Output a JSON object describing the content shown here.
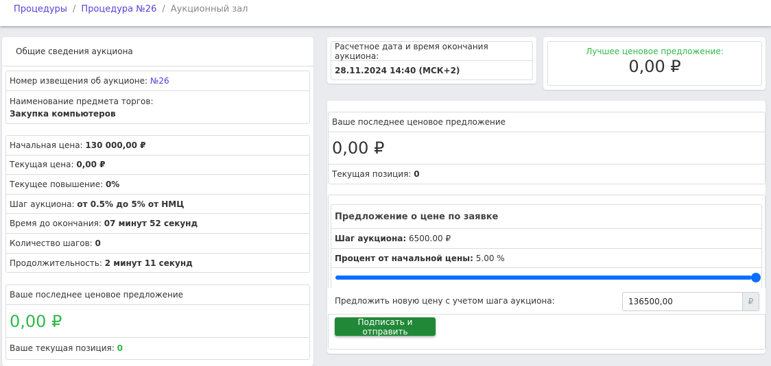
{
  "breadcrumb": {
    "items": [
      "Процедуры",
      "Процедура №26"
    ],
    "current": "Аукционный зал"
  },
  "general": {
    "title": "Общие сведения аукциона",
    "notice_label": "Номер извещения об аукционе:",
    "notice_value": "№26",
    "subject_label": "Наименование предмета торгов:",
    "subject_value": "Закупка компьютеров",
    "params": [
      {
        "label": "Начальная цена:",
        "value": "130 000,00 ₽"
      },
      {
        "label": "Текущая цена:",
        "value": "0,00 ₽"
      },
      {
        "label": "Текущее повышение:",
        "value": "0%"
      },
      {
        "label": "Шаг аукциона:",
        "value": "от 0.5% до 5% от НМЦ"
      },
      {
        "label": "Время до окончания:",
        "value": "07 минут 52 секунд"
      },
      {
        "label": "Количество шагов:",
        "value": "0"
      },
      {
        "label": "Продолжительность:",
        "value": "2 минут 11 секунд"
      }
    ],
    "last_offer_title": "Ваше последнее ценовое предложение",
    "last_offer_value": "0,00 ₽",
    "position_label": "Ваше текущая позиция:",
    "position_value": "0"
  },
  "end_time": {
    "label": "Расчетное дата и время окончания аукциона:",
    "value": "28.11.2024 14:40 (МСК+2)"
  },
  "best_offer": {
    "label": "Лучшее ценовое предложение:",
    "value": "0,00 ₽"
  },
  "my_offer": {
    "title": "Ваше последнее ценовое предложение",
    "value": "0,00 ₽",
    "position_label": "Текущая позиция:",
    "position_value": "0"
  },
  "bid": {
    "title": "Предложение о цене по заявке",
    "step_label": "Шаг аукциона:",
    "step_value": "6500.00 ₽",
    "percent_label": "Процент от начальной цены:",
    "percent_value": "5.00 %",
    "slider_fraction": 1.0,
    "new_price_label": "Предложить новую цену с учетом шага аукциона:",
    "new_price_value": "136500,00",
    "currency": "₽",
    "submit_label": "Подписать и отправить"
  },
  "colors": {
    "accent": "#0d6efd",
    "green": "#2fb84a",
    "button": "#218838",
    "link": "#4a3fd6"
  }
}
